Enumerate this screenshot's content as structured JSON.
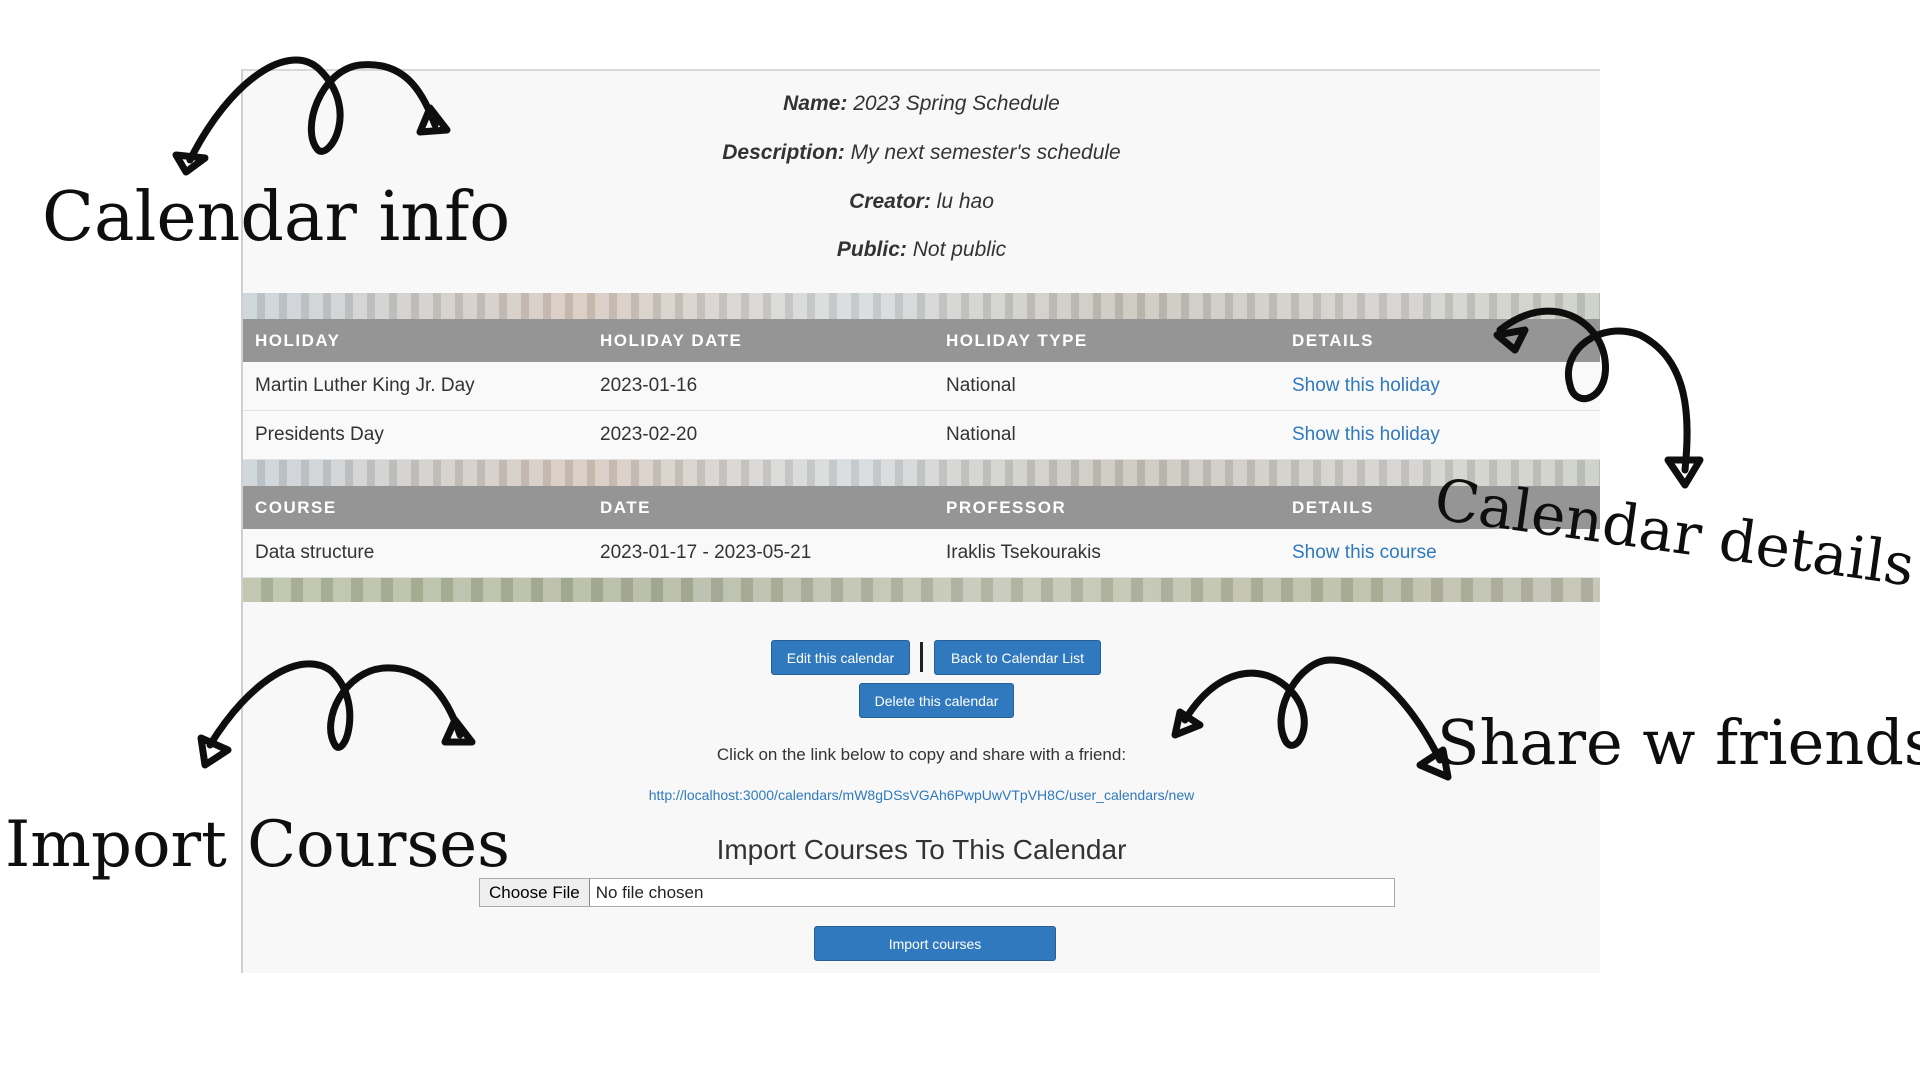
{
  "calendar_info": {
    "name_label": "Name:",
    "name_value": "2023 Spring Schedule",
    "description_label": "Description:",
    "description_value": "My next semester's schedule",
    "creator_label": "Creator:",
    "creator_value": "lu hao",
    "public_label": "Public:",
    "public_value": "Not public"
  },
  "holidays": {
    "headers": [
      "HOLIDAY",
      "HOLIDAY DATE",
      "HOLIDAY TYPE",
      "DETAILS"
    ],
    "rows": [
      {
        "holiday": "Martin Luther King Jr. Day",
        "date": "2023-01-16",
        "type": "National",
        "link": "Show this holiday"
      },
      {
        "holiday": "Presidents Day",
        "date": "2023-02-20",
        "type": "National",
        "link": "Show this holiday"
      }
    ]
  },
  "courses": {
    "headers": [
      "COURSE",
      "DATE",
      "PROFESSOR",
      "DETAILS"
    ],
    "rows": [
      {
        "course": "Data structure",
        "date": "2023-01-17 - 2023-05-21",
        "professor": "Iraklis Tsekourakis",
        "link": "Show this course"
      }
    ]
  },
  "actions": {
    "edit_label": "Edit this calendar",
    "back_label": "Back to Calendar List",
    "delete_label": "Delete this calendar"
  },
  "share": {
    "instruction": "Click on the link below to copy and share with a friend:",
    "url": "http://localhost:3000/calendars/mW8gDSsVGAh6PwpUwVTpVH8C/user_calendars/new"
  },
  "import": {
    "title": "Import Courses To This Calendar",
    "choose_file_label": "Choose File",
    "no_file_label": "No file chosen",
    "submit_label": "Import courses"
  },
  "annotations": {
    "calendar_info": "Calendar info",
    "calendar_details": "Calendar details",
    "import_courses": "Import Courses",
    "share_friends": "Share w friends"
  },
  "colors": {
    "table_header": "#959595",
    "button": "#3179be",
    "link": "#2f79be",
    "panel": "#f8f8f8"
  }
}
